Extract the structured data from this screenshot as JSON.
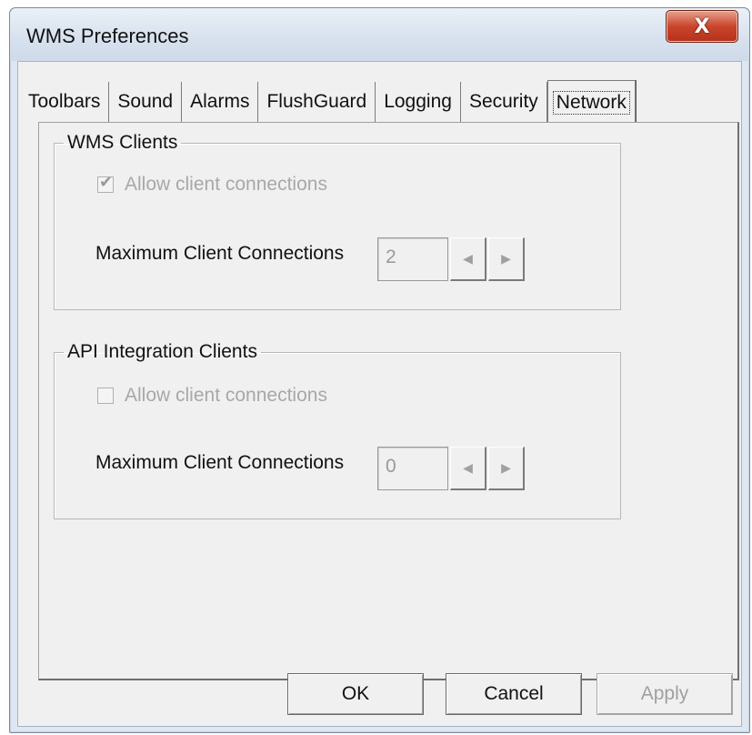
{
  "window": {
    "title": "WMS Preferences",
    "close_glyph": "X"
  },
  "tabs": [
    {
      "label": "Toolbars"
    },
    {
      "label": "Sound"
    },
    {
      "label": "Alarms"
    },
    {
      "label": "FlushGuard"
    },
    {
      "label": "Logging"
    },
    {
      "label": "Security"
    },
    {
      "label": "Network",
      "selected": true
    }
  ],
  "wms_clients": {
    "legend": "WMS Clients",
    "allow_label": "Allow client connections",
    "allow_checked": true,
    "max_label": "Maximum Client Connections",
    "max_value": "2"
  },
  "api_clients": {
    "legend": "API Integration Clients",
    "allow_label": "Allow client connections",
    "allow_checked": false,
    "max_label": "Maximum Client Connections",
    "max_value": "0"
  },
  "buttons": {
    "ok": "OK",
    "cancel": "Cancel",
    "apply": "Apply"
  },
  "icons": {
    "check": "✔",
    "spin_left": "◀",
    "spin_right": "▶"
  }
}
